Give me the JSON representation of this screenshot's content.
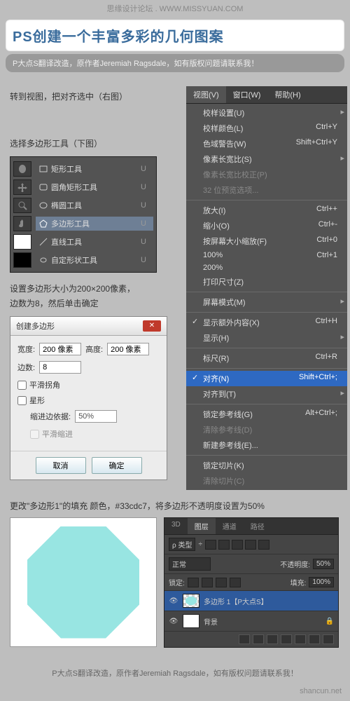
{
  "credits": {
    "top": "思缘设计论坛 . WWW.MISSYUAN.COM",
    "sub": "P大点S翻译改造，原作者Jeremiah Ragsdale，如有版权问题请联系我！",
    "footer": "P大点S翻译改造，原作者Jeremiah Ragsdale，如有版权问题请联系我！",
    "watermark": "shancun.net"
  },
  "title": "PS创建一个丰富多彩的几何图案",
  "instructions": {
    "step1": "转到视图，把对齐选中（右图）",
    "step2": "选择多边形工具（下图）",
    "step3a": "设置多边形大小为200×200像素，",
    "step3b": "边数为8，然后单击确定",
    "step4": "更改\"多边形1\"的填充 颜色，#33cdc7，将多边形不透明度设置为50%"
  },
  "tools": {
    "items": [
      {
        "label": "矩形工具",
        "key": "U",
        "sel": false
      },
      {
        "label": "圆角矩形工具",
        "key": "U",
        "sel": false
      },
      {
        "label": "椭圆工具",
        "key": "U",
        "sel": false
      },
      {
        "label": "多边形工具",
        "key": "U",
        "sel": true
      },
      {
        "label": "直线工具",
        "key": "U",
        "sel": false
      },
      {
        "label": "自定形状工具",
        "key": "U",
        "sel": false
      }
    ]
  },
  "menu": {
    "tabs": [
      "视图(V)",
      "窗口(W)",
      "帮助(H)"
    ],
    "items": [
      {
        "label": "校样设置(U)",
        "sub": true,
        "group": 1
      },
      {
        "label": "校样颜色(L)",
        "shortcut": "Ctrl+Y",
        "group": 1
      },
      {
        "label": "色域警告(W)",
        "shortcut": "Shift+Ctrl+Y",
        "group": 1
      },
      {
        "label": "像素长宽比(S)",
        "sub": true,
        "group": 1
      },
      {
        "label": "像素长宽比校正(P)",
        "disabled": true,
        "group": 1
      },
      {
        "label": "32 位预览选项...",
        "disabled": true,
        "group": 1
      },
      {
        "label": "放大(I)",
        "shortcut": "Ctrl++",
        "group": 2
      },
      {
        "label": "缩小(O)",
        "shortcut": "Ctrl+-",
        "group": 2
      },
      {
        "label": "按屏幕大小缩放(F)",
        "shortcut": "Ctrl+0",
        "group": 2
      },
      {
        "label": "100%",
        "shortcut": "Ctrl+1",
        "group": 2
      },
      {
        "label": "200%",
        "group": 2
      },
      {
        "label": "打印尺寸(Z)",
        "group": 2
      },
      {
        "label": "屏幕模式(M)",
        "sub": true,
        "group": 3
      },
      {
        "label": "显示额外内容(X)",
        "shortcut": "Ctrl+H",
        "check": true,
        "group": 4
      },
      {
        "label": "显示(H)",
        "sub": true,
        "group": 4
      },
      {
        "label": "标尺(R)",
        "shortcut": "Ctrl+R",
        "group": 5
      },
      {
        "label": "对齐(N)",
        "shortcut": "Shift+Ctrl+;",
        "check": true,
        "sel": true,
        "group": 6
      },
      {
        "label": "对齐到(T)",
        "sub": true,
        "group": 6
      },
      {
        "label": "锁定参考线(G)",
        "shortcut": "Alt+Ctrl+;",
        "group": 7
      },
      {
        "label": "清除参考线(D)",
        "disabled": true,
        "group": 7
      },
      {
        "label": "新建参考线(E)...",
        "group": 7
      },
      {
        "label": "锁定切片(K)",
        "group": 8
      },
      {
        "label": "清除切片(C)",
        "disabled": true,
        "group": 8
      }
    ]
  },
  "dialog": {
    "title": "创建多边形",
    "width_lbl": "宽度:",
    "width_val": "200 像素",
    "height_lbl": "高度:",
    "height_val": "200 像素",
    "sides_lbl": "边数:",
    "sides_val": "8",
    "smooth": "平滑拐角",
    "star": "星形",
    "indent_lbl": "缩进边依据:",
    "indent_val": "50%",
    "smooth_indent": "平滑缩进",
    "cancel": "取消",
    "ok": "确定"
  },
  "layers": {
    "tabs": [
      "3D",
      "图层",
      "通道",
      "路径"
    ],
    "kind": "ρ 类型",
    "mode": "正常",
    "opacity_lbl": "不透明度:",
    "opacity_val": "50%",
    "lock_lbl": "锁定:",
    "fill_lbl": "填充:",
    "fill_val": "100%",
    "rows": [
      {
        "name": "多边形 1【P大点S】",
        "sel": true,
        "shape": true
      },
      {
        "name": "背景",
        "sel": false,
        "lock": true
      }
    ]
  },
  "colors": {
    "octagon": "#98e5e2",
    "accent": "#2e69c2"
  }
}
